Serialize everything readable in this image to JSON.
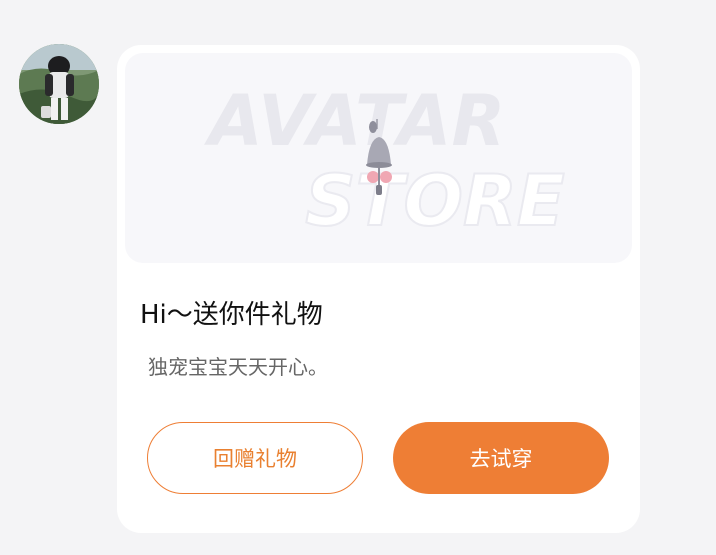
{
  "banner": {
    "watermark_line1": "AVATAR",
    "watermark_line2": "STORE"
  },
  "gift": {
    "title": "Hi～送你件礼物",
    "message": "独宠宝宝天天开心。"
  },
  "actions": {
    "return_gift_label": "回赠礼物",
    "try_on_label": "去试穿"
  },
  "colors": {
    "accent": "#ee7e35",
    "page_background": "#f4f4f6",
    "card_background": "#ffffff",
    "title_text": "#111111",
    "message_text": "#666666"
  },
  "icons": {
    "sender_avatar": "user-photo-avatar",
    "gift_item": "wind-chime-ornament-icon"
  }
}
